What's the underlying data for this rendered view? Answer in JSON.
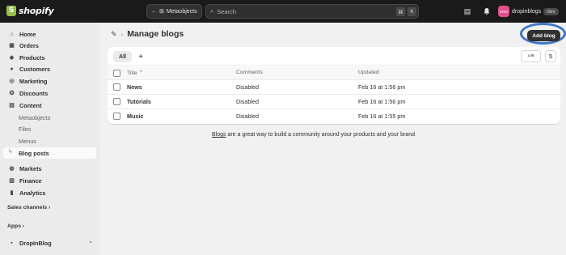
{
  "topbar": {
    "logo_text": "shopify",
    "back_label": "Metaobjects",
    "search_placeholder": "Search",
    "kbd_cmd": "⌘",
    "kbd_key": "K",
    "store_avatar_text": "DRO",
    "store_name": "dropinblogs",
    "store_badge": "dev"
  },
  "sidebar": {
    "items": [
      {
        "label": "Home",
        "icon": "home-icon"
      },
      {
        "label": "Orders",
        "icon": "orders-icon"
      },
      {
        "label": "Products",
        "icon": "tag-icon"
      },
      {
        "label": "Customers",
        "icon": "person-icon"
      },
      {
        "label": "Marketing",
        "icon": "target-icon"
      },
      {
        "label": "Discounts",
        "icon": "discount-icon"
      },
      {
        "label": "Content",
        "icon": "content-icon"
      },
      {
        "label": "Metaobjects"
      },
      {
        "label": "Files"
      },
      {
        "label": "Menus"
      },
      {
        "label": "Blog posts"
      },
      {
        "label": "Markets",
        "icon": "globe-icon"
      },
      {
        "label": "Finance",
        "icon": "bank-icon"
      },
      {
        "label": "Analytics",
        "icon": "chart-icon"
      }
    ],
    "sales_channels": "Sales channels",
    "apps": "Apps",
    "app_item": "DropInBlog"
  },
  "page": {
    "title": "Manage blogs",
    "add_button": "Add blog"
  },
  "table": {
    "tab_all": "All",
    "columns": {
      "title": "Title",
      "comments": "Comments",
      "updated": "Updated"
    },
    "rows": [
      {
        "title": "News",
        "comments": "Disabled",
        "updated": "Feb 16 at 1:56 pm"
      },
      {
        "title": "Tutorials",
        "comments": "Disabled",
        "updated": "Feb 16 at 1:56 pm"
      },
      {
        "title": "Music",
        "comments": "Disabled",
        "updated": "Feb 16 at 1:55 pm"
      }
    ]
  },
  "footer": {
    "link_text": "Blogs",
    "text": " are a great way to build a community around your products and your brand"
  },
  "colors": {
    "topbar": "#1a1a1a",
    "primary_button": "#303030",
    "highlight_ring": "#3f77c7",
    "store_avatar": "#e0508a"
  }
}
